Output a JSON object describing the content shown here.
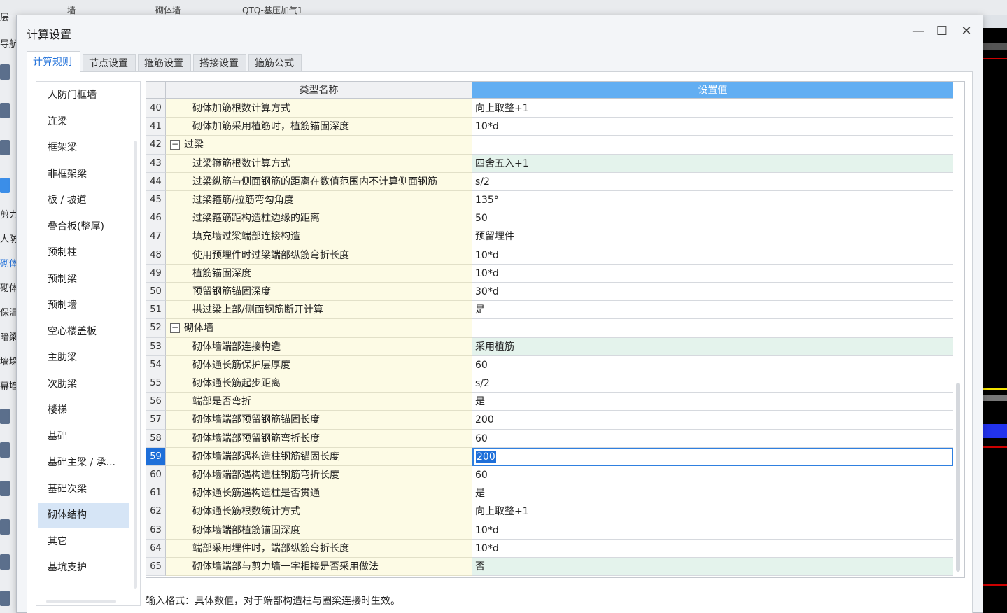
{
  "background": {
    "top_tabs": [
      "墙",
      "砌体墙",
      "QTQ-基压加气1"
    ],
    "left_labels": [
      {
        "text": "层"
      },
      {
        "text": "导航"
      },
      {
        "text": "剪力"
      },
      {
        "text": "人防"
      },
      {
        "text": "砌体"
      },
      {
        "text": "砌体"
      },
      {
        "text": "保温"
      },
      {
        "text": "暗梁"
      },
      {
        "text": "墙垛"
      },
      {
        "text": "幕墙"
      }
    ]
  },
  "dialog": {
    "title": "计算设置",
    "controls": {
      "minimize": "—",
      "maximize": "☐",
      "close": "✕"
    },
    "tabs": [
      {
        "label": "计算规则",
        "active": true
      },
      {
        "label": "节点设置",
        "active": false
      },
      {
        "label": "箍筋设置",
        "active": false
      },
      {
        "label": "搭接设置",
        "active": false
      },
      {
        "label": "箍筋公式",
        "active": false
      }
    ],
    "categories": [
      {
        "label": "人防门框墙"
      },
      {
        "label": "连梁"
      },
      {
        "label": "框架梁"
      },
      {
        "label": "非框架梁"
      },
      {
        "label": "板 / 坡道"
      },
      {
        "label": "叠合板(整厚)"
      },
      {
        "label": "预制柱"
      },
      {
        "label": "预制梁"
      },
      {
        "label": "预制墙"
      },
      {
        "label": "空心楼盖板"
      },
      {
        "label": "主肋梁"
      },
      {
        "label": "次肋梁"
      },
      {
        "label": "楼梯"
      },
      {
        "label": "基础"
      },
      {
        "label": "基础主梁 / 承..."
      },
      {
        "label": "基础次梁"
      },
      {
        "label": "砌体结构",
        "selected": true
      },
      {
        "label": "其它"
      },
      {
        "label": "基坑支护"
      }
    ],
    "grid": {
      "headers": {
        "name": "类型名称",
        "value": "设置值"
      },
      "rows": [
        {
          "n": "40",
          "name": "砌体加筋根数计算方式",
          "value": "向上取整+1"
        },
        {
          "n": "41",
          "name": "砌体加筋采用植筋时，植筋锚固深度",
          "value": "10*d"
        },
        {
          "n": "42",
          "name": "过梁",
          "value": "",
          "group": true,
          "toggle": "−"
        },
        {
          "n": "43",
          "name": "过梁箍筋根数计算方式",
          "value": "四舍五入+1",
          "highlight": true
        },
        {
          "n": "44",
          "name": "过梁纵筋与侧面钢筋的距离在数值范围内不计算侧面钢筋",
          "value": "s/2"
        },
        {
          "n": "45",
          "name": "过梁箍筋/拉筋弯勾角度",
          "value": "135°"
        },
        {
          "n": "46",
          "name": "过梁箍筋距构造柱边缘的距离",
          "value": "50"
        },
        {
          "n": "47",
          "name": "填充墙过梁端部连接构造",
          "value": "预留埋件"
        },
        {
          "n": "48",
          "name": "使用预埋件时过梁端部纵筋弯折长度",
          "value": "10*d"
        },
        {
          "n": "49",
          "name": "植筋锚固深度",
          "value": "10*d"
        },
        {
          "n": "50",
          "name": "预留钢筋锚固深度",
          "value": "30*d"
        },
        {
          "n": "51",
          "name": "拱过梁上部/侧面钢筋断开计算",
          "value": "是"
        },
        {
          "n": "52",
          "name": "砌体墙",
          "value": "",
          "group": true,
          "toggle": "−"
        },
        {
          "n": "53",
          "name": "砌体墙端部连接构造",
          "value": "采用植筋",
          "highlight": true
        },
        {
          "n": "54",
          "name": "砌体通长筋保护层厚度",
          "value": "60"
        },
        {
          "n": "55",
          "name": "砌体通长筋起步距离",
          "value": "s/2"
        },
        {
          "n": "56",
          "name": "端部是否弯折",
          "value": "是"
        },
        {
          "n": "57",
          "name": "砌体墙端部预留钢筋锚固长度",
          "value": "200"
        },
        {
          "n": "58",
          "name": "砌体墙端部预留钢筋弯折长度",
          "value": "60"
        },
        {
          "n": "59",
          "name": "砌体墙端部遇构造柱钢筋锚固长度",
          "value": "200",
          "current": true
        },
        {
          "n": "60",
          "name": "砌体墙端部遇构造柱钢筋弯折长度",
          "value": "60"
        },
        {
          "n": "61",
          "name": "砌体通长筋遇构造柱是否贯通",
          "value": "是"
        },
        {
          "n": "62",
          "name": "砌体通长筋根数统计方式",
          "value": "向上取整+1"
        },
        {
          "n": "63",
          "name": "砌体墙端部植筋锚固深度",
          "value": "10*d"
        },
        {
          "n": "64",
          "name": "端部采用埋件时，端部纵筋弯折长度",
          "value": "10*d"
        },
        {
          "n": "65",
          "name": "砌体墙端部与剪力墙一字相接是否采用做法",
          "value": "否",
          "highlight": true
        }
      ]
    },
    "hint": "输入格式：具体数值，对于端部构造柱与圈梁连接时生效。"
  }
}
